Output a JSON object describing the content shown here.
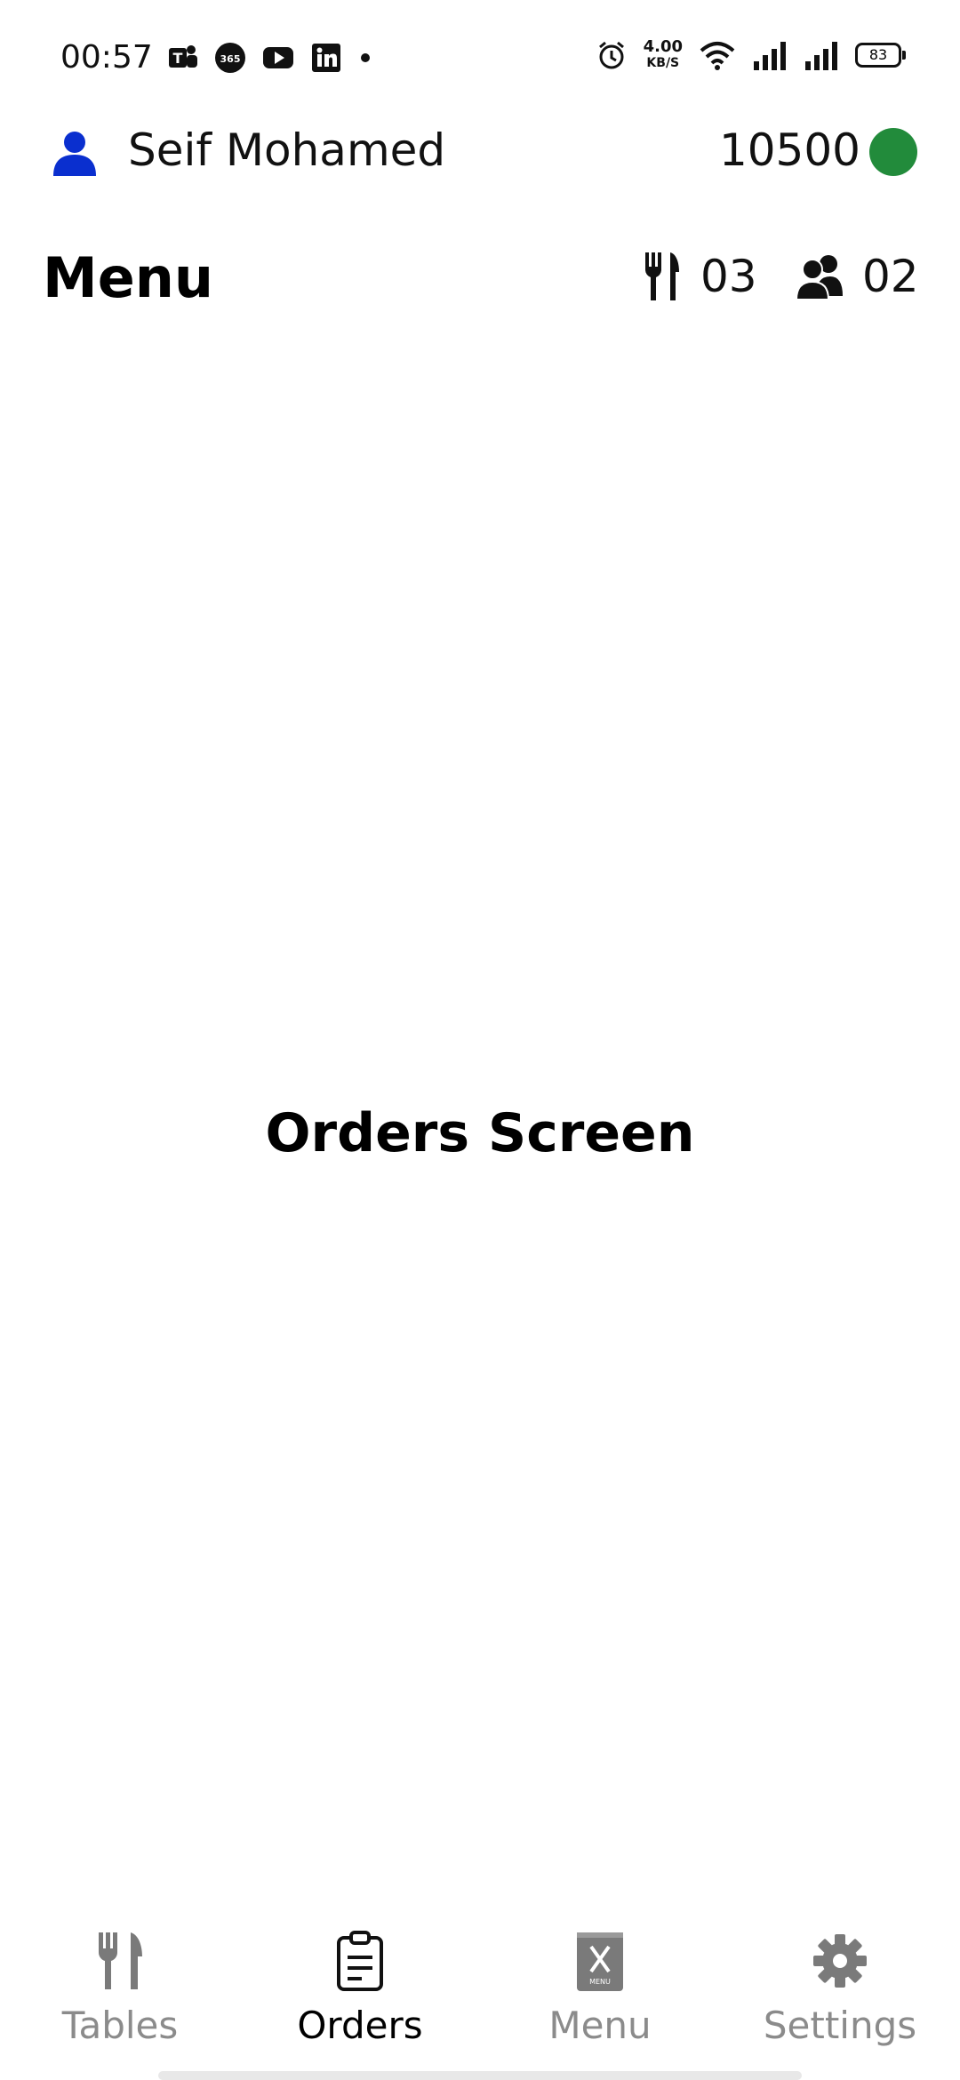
{
  "status_bar": {
    "time": "00:57",
    "left_icons": [
      "teams-icon",
      "office365-icon",
      "youtube-icon",
      "linkedin-icon",
      "notification-dot"
    ],
    "net_speed_value": "4.00",
    "net_speed_unit": "KB/S",
    "battery": "83"
  },
  "header": {
    "user_name": "Seif Mohamed",
    "points": "10500",
    "online_color": "#228b3b",
    "user_icon_color": "#0a2fcf"
  },
  "title_bar": {
    "title": "Menu",
    "tables_count": "03",
    "guests_count": "02"
  },
  "main": {
    "label": "Orders Screen"
  },
  "bottom_nav": {
    "items": [
      {
        "label": "Tables",
        "icon": "cutlery-icon"
      },
      {
        "label": "Orders",
        "icon": "clipboard-icon"
      },
      {
        "label": "Menu",
        "icon": "menu-book-icon"
      },
      {
        "label": "Settings",
        "icon": "gear-icon"
      }
    ],
    "active_index": 1
  }
}
